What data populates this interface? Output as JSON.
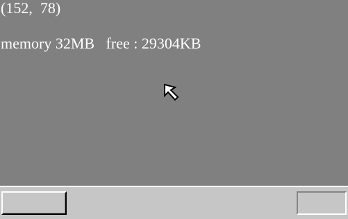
{
  "desktop": {
    "coords_text": "(152,  78)",
    "memory_text": "memory 32MB   free : 29304KB",
    "background_color": "#808080",
    "text_color": "#ffffff"
  },
  "cursor": {
    "icon": "arrow-pointer-icon"
  },
  "taskbar": {
    "background_color": "#c6c6c6",
    "left_button_label": "",
    "tray_label": ""
  }
}
